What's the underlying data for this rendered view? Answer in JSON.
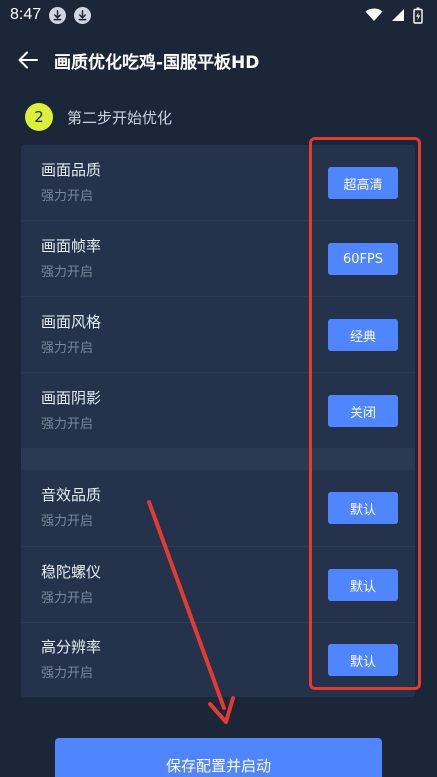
{
  "status_bar": {
    "time": "8:47",
    "icons": [
      "download-icon",
      "download-icon",
      "wifi-icon",
      "signal-icon",
      "battery-charging-icon"
    ]
  },
  "header": {
    "title": "画质优化吃鸡-国服平板HD",
    "back_icon": "arrow-left-icon"
  },
  "step": {
    "number": "2",
    "label": "第二步开始优化"
  },
  "settings": [
    {
      "title": "画面品质",
      "subtitle": "强力开启",
      "value": "超高清"
    },
    {
      "title": "画面帧率",
      "subtitle": "强力开启",
      "value": "60FPS"
    },
    {
      "title": "画面风格",
      "subtitle": "强力开启",
      "value": "经典"
    },
    {
      "title": "画面阴影",
      "subtitle": "强力开启",
      "value": "关闭"
    },
    {
      "title": "音效品质",
      "subtitle": "强力开启",
      "value": "默认"
    },
    {
      "title": "稳陀螺仪",
      "subtitle": "强力开启",
      "value": "默认"
    },
    {
      "title": "高分辨率",
      "subtitle": "强力开启",
      "value": "默认"
    }
  ],
  "footer": {
    "save_label": "保存配置并启动"
  },
  "colors": {
    "background": "#1b2638",
    "panel": "#24334b",
    "accent": "#4f86ff",
    "step_badge": "#dcf03a",
    "annotation_red": "#e23b32"
  }
}
